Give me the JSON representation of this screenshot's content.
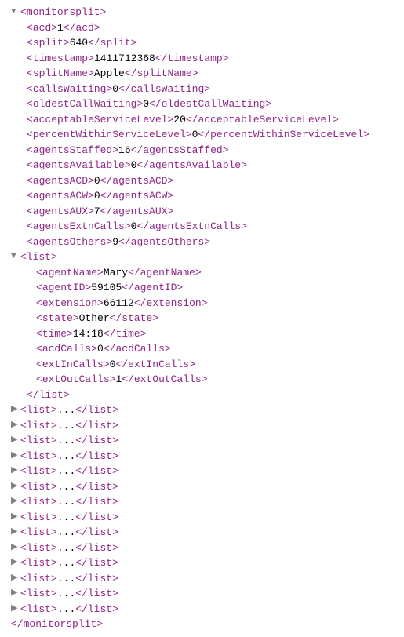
{
  "root": {
    "name": "monitorsplit",
    "fields": [
      {
        "tag": "acd",
        "value": "1"
      },
      {
        "tag": "split",
        "value": "640"
      },
      {
        "tag": "timestamp",
        "value": "1411712368"
      },
      {
        "tag": "splitName",
        "value": "Apple"
      },
      {
        "tag": "callsWaiting",
        "value": "0"
      },
      {
        "tag": "oldestCallWaiting",
        "value": "0"
      },
      {
        "tag": "acceptableServiceLevel",
        "value": "20"
      },
      {
        "tag": "percentWithinServiceLevel",
        "value": "0"
      },
      {
        "tag": "agentsStaffed",
        "value": "16"
      },
      {
        "tag": "agentsAvailable",
        "value": "0"
      },
      {
        "tag": "agentsACD",
        "value": "0"
      },
      {
        "tag": "agentsACW",
        "value": "0"
      },
      {
        "tag": "agentsAUX",
        "value": "7"
      },
      {
        "tag": "agentsExtnCalls",
        "value": "0"
      },
      {
        "tag": "agentsOthers",
        "value": "9"
      }
    ],
    "list_tag": "list",
    "expanded_list": [
      {
        "tag": "agentName",
        "value": "Mary"
      },
      {
        "tag": "agentID",
        "value": "59105"
      },
      {
        "tag": "extension",
        "value": "66112"
      },
      {
        "tag": "state",
        "value": "Other"
      },
      {
        "tag": "time",
        "value": "14:18"
      },
      {
        "tag": "acdCalls",
        "value": "0"
      },
      {
        "tag": "extInCalls",
        "value": "0"
      },
      {
        "tag": "extOutCalls",
        "value": "1"
      }
    ],
    "collapsed_list_count": 14,
    "twisty_expanded": "▼",
    "twisty_collapsed": "▶",
    "ellipsis": "..."
  }
}
